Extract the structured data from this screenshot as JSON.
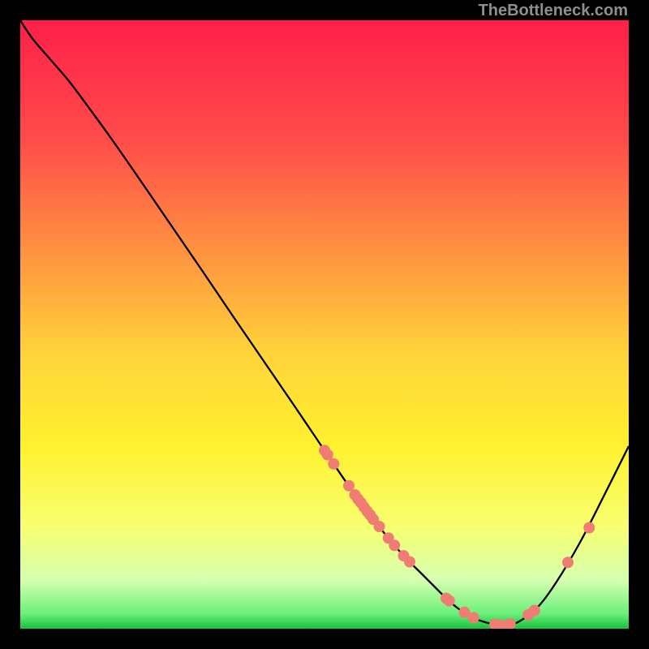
{
  "attribution": "TheBottleneck.com",
  "gradient": {
    "stops": [
      {
        "offset": 0.0,
        "color": "#ff1f4a"
      },
      {
        "offset": 0.2,
        "color": "#ff4d4a"
      },
      {
        "offset": 0.4,
        "color": "#ff9a3f"
      },
      {
        "offset": 0.55,
        "color": "#ffd43a"
      },
      {
        "offset": 0.7,
        "color": "#fff12f"
      },
      {
        "offset": 0.83,
        "color": "#f8ff6f"
      },
      {
        "offset": 0.92,
        "color": "#d6ffb0"
      },
      {
        "offset": 0.975,
        "color": "#6cf07a"
      },
      {
        "offset": 1.0,
        "color": "#17c23c"
      }
    ]
  },
  "chart_data": {
    "type": "line",
    "title": "",
    "xlabel": "",
    "ylabel": "",
    "xlim": [
      0,
      100
    ],
    "ylim": [
      0,
      100
    ],
    "x": [
      0,
      2,
      5,
      8,
      11,
      15,
      20,
      25,
      30,
      35,
      40,
      45,
      50,
      55,
      58,
      60,
      63,
      66,
      68,
      70,
      72,
      74,
      76,
      78,
      80,
      82,
      85,
      88,
      92,
      96,
      100
    ],
    "y": [
      100,
      97,
      93.5,
      90,
      86,
      80.5,
      73.3,
      66.0,
      58.7,
      51.3,
      44.0,
      36.7,
      29.3,
      22.0,
      18.0,
      15.5,
      12.0,
      9.0,
      7.0,
      5.0,
      3.3,
      2.0,
      1.2,
      0.7,
      0.6,
      1.2,
      3.5,
      7.5,
      14.2,
      22.0,
      30.0
    ],
    "data_markers": {
      "x": [
        50.0,
        50.5,
        51.5,
        54.0,
        55.0,
        55.5,
        56.0,
        56.5,
        57.0,
        57.5,
        58.0,
        59.0,
        60.5,
        61.5,
        63.0,
        64.0,
        70.0,
        70.5,
        73.0,
        74.5,
        78.0,
        79.0,
        80.5,
        83.5,
        84.5,
        90.0,
        93.5
      ],
      "y": [
        29.3,
        28.6,
        27.1,
        23.5,
        22.0,
        21.3,
        20.7,
        20.0,
        19.3,
        18.7,
        18.0,
        16.8,
        14.9,
        13.7,
        12.0,
        11.0,
        5.0,
        4.6,
        2.7,
        1.8,
        0.7,
        0.6,
        0.8,
        2.3,
        3.0,
        10.9,
        16.6
      ],
      "color": "#ef7d74",
      "radius": 7
    },
    "line_style": {
      "color": "#000000",
      "width": 2.3
    }
  }
}
